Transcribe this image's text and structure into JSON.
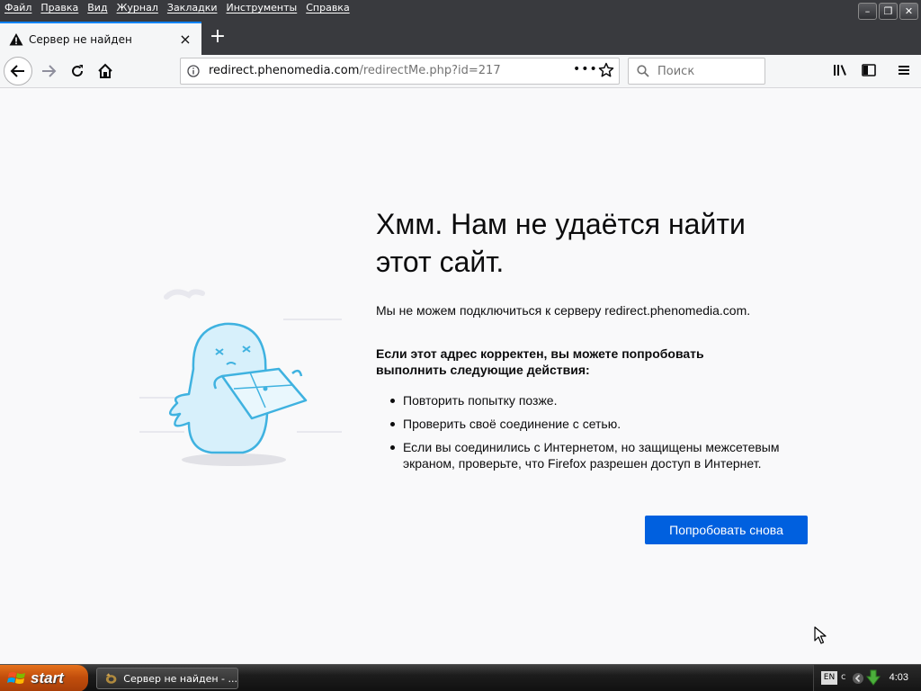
{
  "menubar": {
    "items": [
      "Файл",
      "Правка",
      "Вид",
      "Журнал",
      "Закладки",
      "Инструменты",
      "Справка"
    ]
  },
  "window_controls": {
    "minimize": "–",
    "restore": "❐",
    "close": "✕"
  },
  "tab": {
    "title": "Сервер не найден",
    "close": "×"
  },
  "newtab": {
    "label": "+"
  },
  "urlbar": {
    "host": "redirect.phenomedia.com",
    "path": "/redirectMe.php?id=217",
    "dots": "•••"
  },
  "search": {
    "placeholder": "Поиск"
  },
  "error": {
    "title": "Хмм. Нам не удаётся найти этот сайт.",
    "description": "Мы не можем подключиться к серверу redirect.phenomedia.com.",
    "subhead": "Если этот адрес корректен, вы можете попробовать выполнить следующие действия:",
    "suggestions": [
      "Повторить попытку позже.",
      "Проверить своё соединение с сетью.",
      "Если вы соединились с Интернетом, но защищены межсетевым экраном, проверьте, что Firefox разрешен доступ в Интернет."
    ],
    "retry_label": "Попробовать снова"
  },
  "taskbar": {
    "start_label": "start",
    "task_label": "Сервер не найден - ...",
    "lang": "EN",
    "tray_text": "c",
    "clock": "4:03"
  },
  "colors": {
    "accent": "#0060df",
    "tab_indicator": "#0a84ff",
    "chrome_dark": "#393a3e",
    "page_bg": "#f9f9fa"
  }
}
